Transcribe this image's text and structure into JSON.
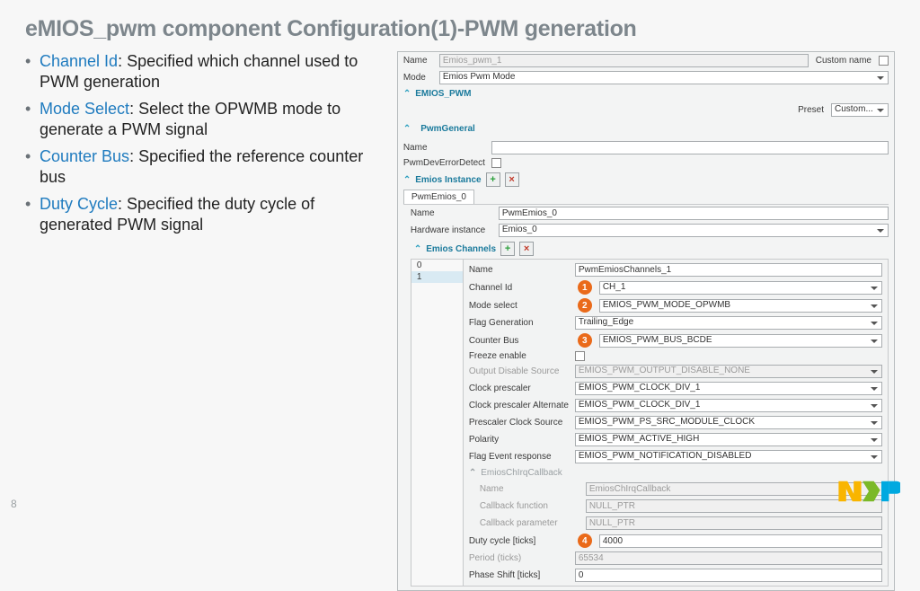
{
  "title": "eMIOS_pwm component Configuration(1)-PWM generation",
  "page": "8",
  "bullets": [
    {
      "k": "Channel Id",
      "t": ": Specified which channel used to PWM generation"
    },
    {
      "k": "Mode Select",
      "t": ": Select the OPWMB mode to generate a PWM signal"
    },
    {
      "k": "Counter Bus",
      "t": ": Specified the reference counter bus"
    },
    {
      "k": "Duty Cycle",
      "t": ": Specified the duty cycle of generated PWM signal"
    }
  ],
  "top": {
    "name_lbl": "Name",
    "name_val": "Emios_pwm_1",
    "custom_lbl": "Custom name",
    "mode_lbl": "Mode",
    "mode_val": "Emios Pwm Mode"
  },
  "sec_main": "EMIOS_PWM",
  "preset_lbl": "Preset",
  "preset_val": "Custom...",
  "sec_gen": "PwmGeneral",
  "gen": {
    "name_lbl": "Name",
    "name_val": "",
    "err_lbl": "PwmDevErrorDetect"
  },
  "sec_inst": "Emios Instance",
  "inst_tab": "PwmEmios_0",
  "inst": {
    "name_lbl": "Name",
    "name_val": "PwmEmios_0",
    "hw_lbl": "Hardware instance",
    "hw_val": "Emios_0"
  },
  "sec_ch": "Emios Channels",
  "ch_list": [
    "0",
    "1"
  ],
  "ch": {
    "name_lbl": "Name",
    "name_val": "PwmEmiosChannels_1",
    "chid_lbl": "Channel Id",
    "chid_val": "CH_1",
    "mode_lbl": "Mode select",
    "mode_val": "EMIOS_PWM_MODE_OPWMB",
    "flag_lbl": "Flag Generation",
    "flag_val": "Trailing_Edge",
    "bus_lbl": "Counter Bus",
    "bus_val": "EMIOS_PWM_BUS_BCDE",
    "freeze_lbl": "Freeze enable",
    "ods_lbl": "Output Disable Source",
    "ods_val": "EMIOS_PWM_OUTPUT_DISABLE_NONE",
    "cp_lbl": "Clock prescaler",
    "cp_val": "EMIOS_PWM_CLOCK_DIV_1",
    "cpa_lbl": "Clock prescaler Alternate",
    "cpa_val": "EMIOS_PWM_CLOCK_DIV_1",
    "pcs_lbl": "Prescaler Clock Source",
    "pcs_val": "EMIOS_PWM_PS_SRC_MODULE_CLOCK",
    "pol_lbl": "Polarity",
    "pol_val": "EMIOS_PWM_ACTIVE_HIGH",
    "fer_lbl": "Flag Event response",
    "fer_val": "EMIOS_PWM_NOTIFICATION_DISABLED",
    "cb_sec": "EmiosChIrqCallback",
    "cb_name_lbl": "Name",
    "cb_name_val": "EmiosChIrqCallback",
    "cb_fn_lbl": "Callback function",
    "cb_fn_val": "NULL_PTR",
    "cb_pr_lbl": "Callback parameter",
    "cb_pr_val": "NULL_PTR",
    "duty_lbl": "Duty cycle [ticks]",
    "duty_val": "4000",
    "per_lbl": "Period (ticks)",
    "per_val": "65534",
    "ps_lbl": "Phase Shift [ticks]",
    "ps_val": "0"
  },
  "callouts": {
    "c1": "1",
    "c2": "2",
    "c3": "3",
    "c4": "4"
  }
}
